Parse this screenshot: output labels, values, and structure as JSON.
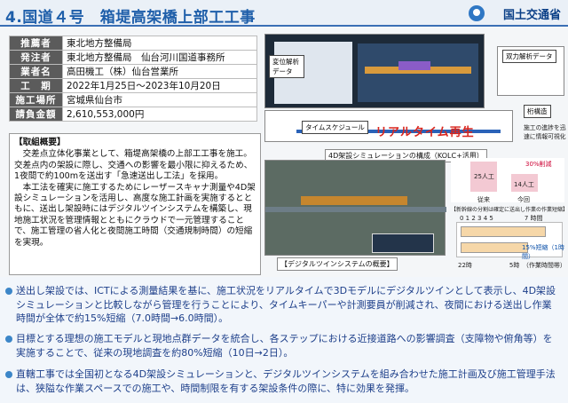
{
  "header": {
    "title": "4.国道４号　箱堤高架橋上部工工事",
    "ministry": "国土交通省"
  },
  "info": [
    {
      "k": "推薦者",
      "v": "東北地方整備局"
    },
    {
      "k": "発注者",
      "v": "東北地方整備局　仙台河川国道事務所"
    },
    {
      "k": "業者名",
      "v": "高田機工（株）仙台営業所"
    },
    {
      "k": "工　期",
      "v": "2022年1月25日～2023年10月20日"
    },
    {
      "k": "施工場所",
      "v": "宮城県仙台市"
    },
    {
      "k": "請負金額",
      "v": "2,610,553,000円"
    }
  ],
  "summary": {
    "heading": "【取組概要】",
    "p1": "交差点立体化事業として、箱堤高架橋の上部工工事を施工。交差点内の架設に際し、交通への影響を最小限に抑えるため、1夜間で約100mを送出す「急速送出し工法」を採用。",
    "p2": "本工法を確実に施工するためにレーザースキャナ測量や4D架設シミュレーションを活用し、高度な施工計画を実施するとともに、送出し架設時にはデジタルツインシステムを構築し、現地施工状況を管理情報とともにクラウドで一元管理することで、施工管理の省人化と夜間施工時間（交通規制時間）の短縮を実現。"
  },
  "figures": {
    "tag_position": "変位解析データ",
    "tag_timeschedule": "タイムスケジュール",
    "tag_analysis": "双力解析データ",
    "tag_steel": "桁構造",
    "tag_status": "施工の進捗を迅速に情報可視化",
    "realtime": "リアルタイム再生",
    "caption_4d": "4D架設シミュレーションの構成（KOLC+活用）",
    "caption_twin": "【デジタルツインシステムの概要】",
    "chart_left_label": "従来",
    "chart_right_label": "今回",
    "chart_left_value": "25人工",
    "chart_right_value": "14人工",
    "chart_reduction": "30%削減",
    "time_note": "【新幹線の分割は確定に送出し作業の作業短縮】",
    "time_axis": "0 1 2 3 4 5　　　　　7 時間",
    "time_reduction": "15%短縮（1時間）",
    "time_foot": "22時　　　　　　5時　（作業時間帯）"
  },
  "bullets": [
    "送出し架設では、ICTによる測量結果を基に、施工状況をリアルタイムで3Dモデルにデジタルツインとして表示し、4D架設シミュレーションと比較しながら管理を行うことにより、タイムキーパーや計測要員が削減され、夜間における送出し作業時間が全体で約15%短縮（7.0時間→6.0時間）。",
    "目標とする理想の施工モデルと現地点群データを統合し、各ステップにおける近接道路への影響調査（支障物や俯角等）を実施することで、従来の現地調査を約80%短縮（10日→2日）。",
    "直轄工事では全国初となる4D架設シミュレーションと、デジタルツインシステムを組み合わせた施工計画及び施工管理手法は、狭隘な作業スペースでの施工や、時間制限を有する架設条件の際に、特に効果を発揮。"
  ]
}
